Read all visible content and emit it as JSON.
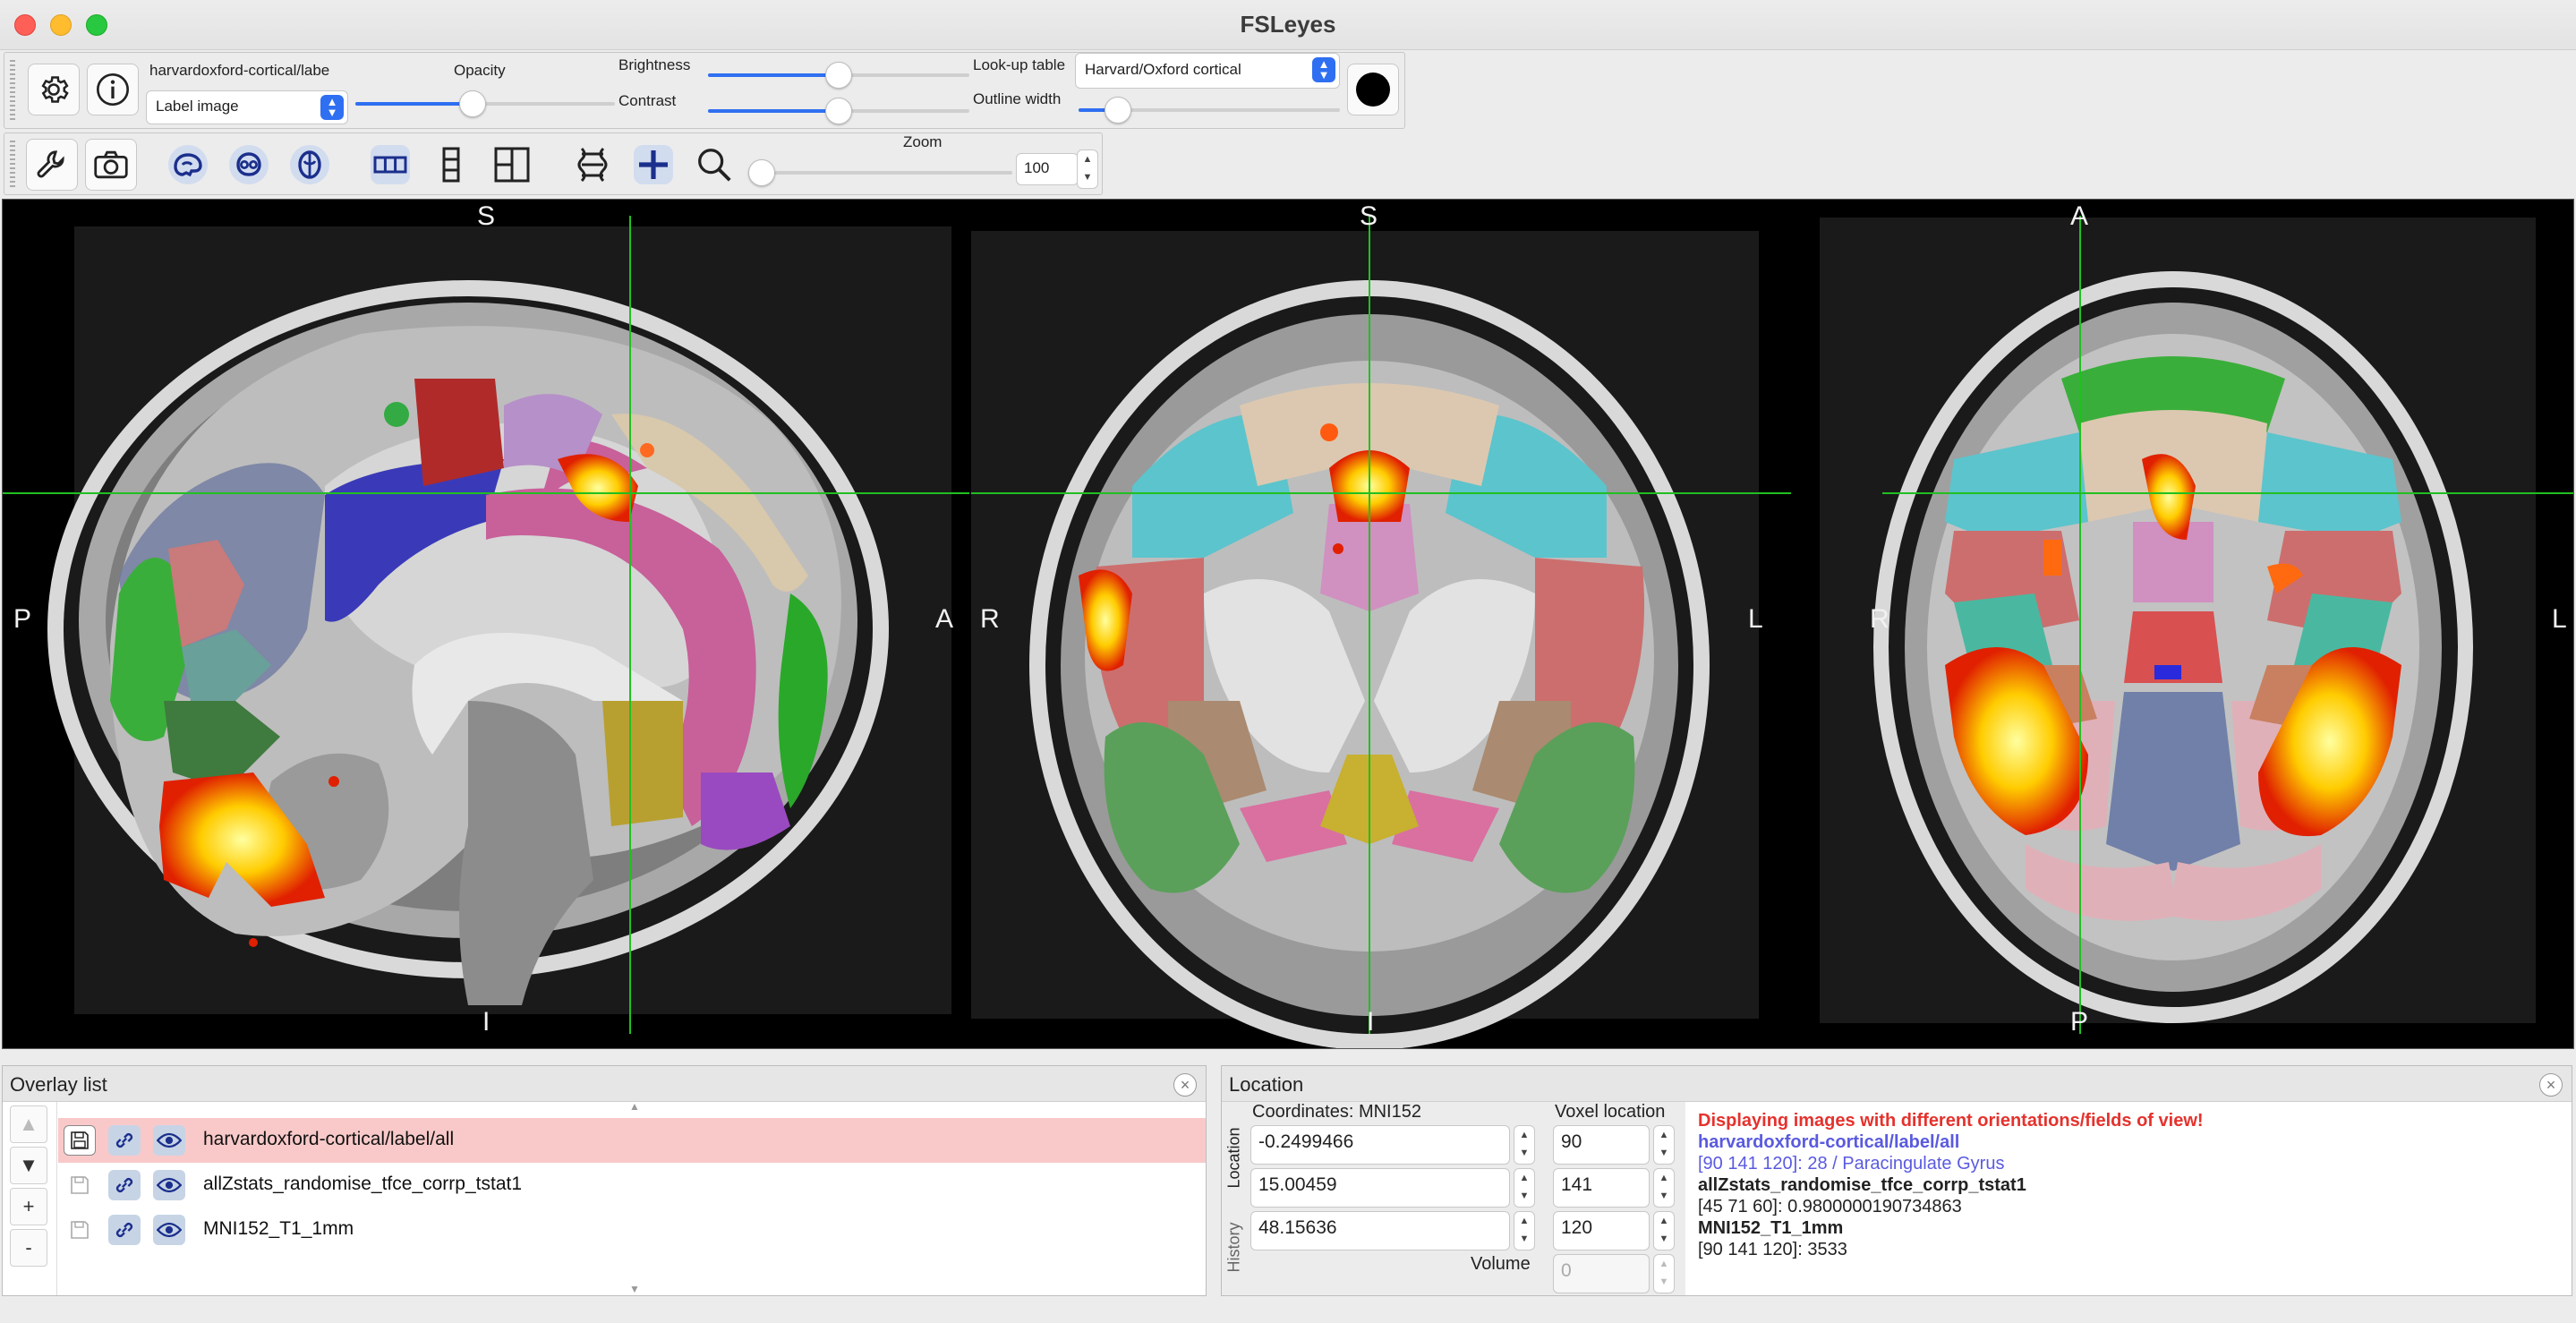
{
  "window": {
    "title": "FSLeyes"
  },
  "overlay_toolbar": {
    "overlay_name": "harvardoxford-cortical/labe",
    "overlay_type": "Label image",
    "opacity_label": "Opacity",
    "opacity_level": 0.45,
    "brightness_label": "Brightness",
    "brightness_level": 0.5,
    "contrast_label": "Contrast",
    "contrast_level": 0.5,
    "lut_label": "Look-up table",
    "lut_value": "Harvard/Oxford cortical",
    "outline_label": "Outline width",
    "outline_level": 0.15,
    "outline_color": "#000000"
  },
  "view_toolbar": {
    "zoom_label": "Zoom",
    "zoom_value": "100",
    "zoom_level": 0
  },
  "canvas": {
    "sagittal": {
      "top": "S",
      "bottom": "I",
      "left": "P",
      "right": "A"
    },
    "coronal": {
      "top": "S",
      "bottom": "I",
      "left": "R",
      "right": "L"
    },
    "axial": {
      "top": "A",
      "bottom": "P",
      "left": "R",
      "right": "L"
    },
    "cursor_color": "#20c020"
  },
  "overlay_list": {
    "title": "Overlay list",
    "controls": [
      "▲",
      "▼",
      "+",
      "-"
    ],
    "items": [
      {
        "name": "harvardoxford-cortical/label/all",
        "selected": true
      },
      {
        "name": "allZstats_randomise_tfce_corrp_tstat1",
        "selected": false
      },
      {
        "name": "MNI152_T1_1mm",
        "selected": false
      }
    ]
  },
  "location": {
    "title": "Location",
    "tab_location": "Location",
    "tab_history": "History",
    "coords_label": "Coordinates: MNI152",
    "coords": [
      "-0.2499466",
      "15.00459",
      "48.15636"
    ],
    "voxel_label": "Voxel location",
    "voxels": [
      "90",
      "141",
      "120"
    ],
    "volume_label": "Volume",
    "volume_value": "0",
    "info": {
      "warning": "Displaying images with different orientations/fields of view!",
      "o1_name": "harvardoxford-cortical/label/all",
      "o1_value": "[90 141 120]: 28 / Paracingulate Gyrus",
      "o2_name": "allZstats_randomise_tfce_corrp_tstat1",
      "o2_value": "[45 71 60]: 0.9800000190734863",
      "o3_name": "MNI152_T1_1mm",
      "o3_value": "[90 141 120]: 3533"
    },
    "colors": {
      "warning": "#e5322d",
      "selected": "#5a5ae0",
      "normal": "#111111"
    }
  }
}
